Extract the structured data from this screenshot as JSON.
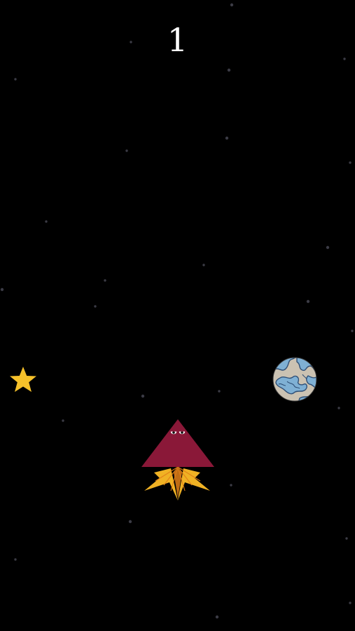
{
  "hud": {
    "score": "1"
  },
  "colors": {
    "background": "#000000",
    "score_text": "#ffffff",
    "star_pickup": "#f6c12a",
    "rocket_body": "#8a1838",
    "rocket_flame": "#f0b224",
    "rocket_flame_inner": "#e27f18",
    "planet_land": "#cbc2b2",
    "planet_water": "#7fb0d4",
    "planet_outline": "#2f4f76"
  },
  "sprites": {
    "star_pickup": "star-icon",
    "planet": "planet-icon",
    "player": "rocket-ship"
  }
}
